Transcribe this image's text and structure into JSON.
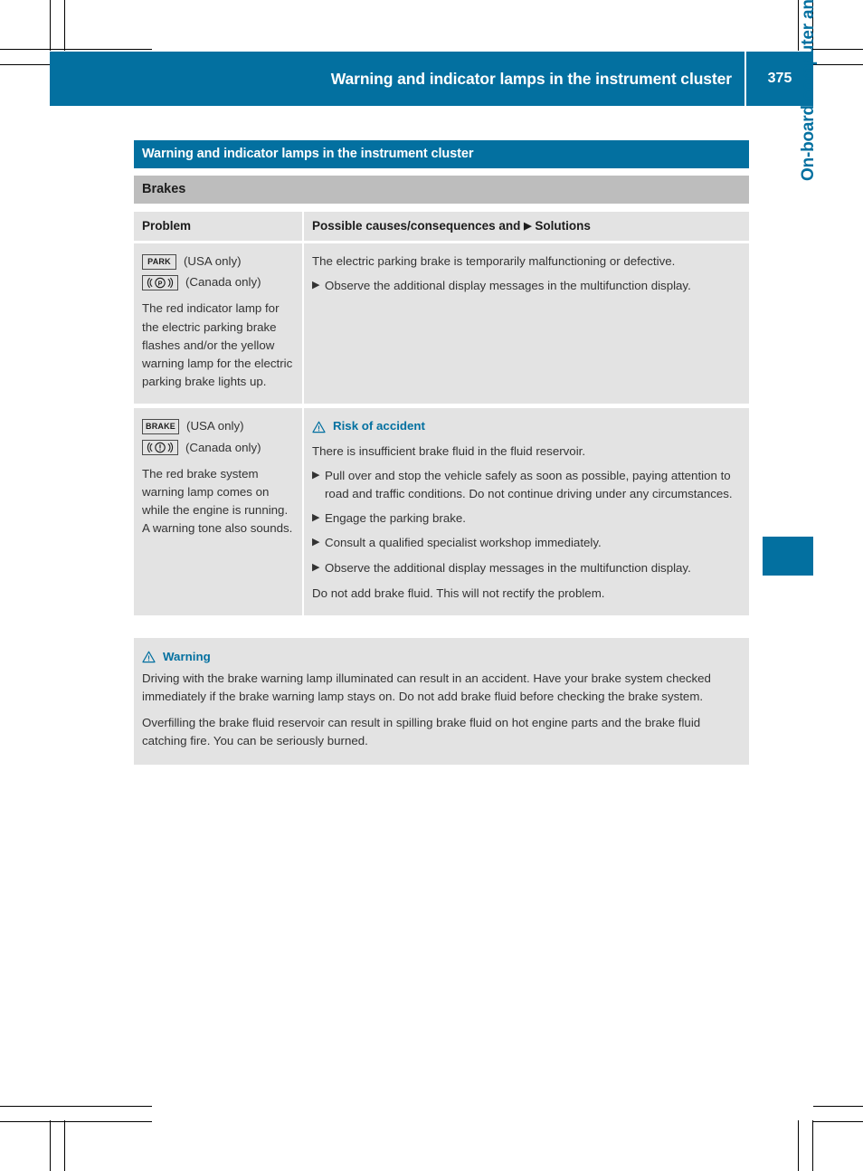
{
  "colors": {
    "accent_blue": "#0370a0",
    "subtitle_gray": "#bdbdbd",
    "cell_gray": "#e3e3e3",
    "text": "#333333"
  },
  "running_header": {
    "title": "Warning and indicator lamps in the instrument cluster",
    "page_number": "375"
  },
  "chapter_tab": {
    "label": "On-board computer and displays"
  },
  "table": {
    "title": "Warning and indicator lamps in the instrument cluster",
    "subtitle": "Brakes",
    "columns": {
      "problem": "Problem",
      "solutions_pre": "Possible causes/consequences and",
      "solutions_bullet": "▶",
      "solutions_post": "Solutions"
    },
    "rows": [
      {
        "symbols": [
          {
            "glyph": "PARK",
            "kind": "text-box",
            "caption": "(USA only)"
          },
          {
            "glyph": "(P)",
            "kind": "circle-p-box",
            "caption": "(Canada only)"
          }
        ],
        "problem_text": "The red indicator lamp for the electric parking brake flashes and/or the yellow warning lamp for the electric parking brake lights up.",
        "cause_text": "The electric parking brake is temporarily malfunctioning or defective.",
        "bullets": [
          "Observe the additional display messages in the multifunction display."
        ],
        "trailing_text": ""
      },
      {
        "symbols": [
          {
            "glyph": "BRAKE",
            "kind": "text-box",
            "caption": "(USA only)"
          },
          {
            "glyph": "(!)",
            "kind": "circle-excl-box",
            "caption": "(Canada only)"
          }
        ],
        "problem_text": "The red brake system warning lamp comes on while the engine is running. A warning tone also sounds.",
        "hazard_title": "Risk of accident",
        "cause_text": "There is insufficient brake fluid in the fluid reservoir.",
        "bullets": [
          "Pull over and stop the vehicle safely as soon as possible, paying attention to road and traffic conditions. Do not continue driving under any circumstances.",
          "Engage the parking brake.",
          "Consult a qualified specialist workshop immediately.",
          "Observe the additional display messages in the multifunction display."
        ],
        "trailing_text": "Do not add brake fluid. This will not rectify the problem."
      }
    ]
  },
  "warning_box": {
    "title": "Warning",
    "paragraphs": [
      "Driving with the brake warning lamp illuminated can result in an accident. Have your brake system checked immediately if the brake warning lamp stays on. Do not add brake fluid before checking the brake system.",
      "Overfilling the brake fluid reservoir can result in spilling brake fluid on hot engine parts and the brake fluid catching fire. You can be seriously burned."
    ]
  }
}
